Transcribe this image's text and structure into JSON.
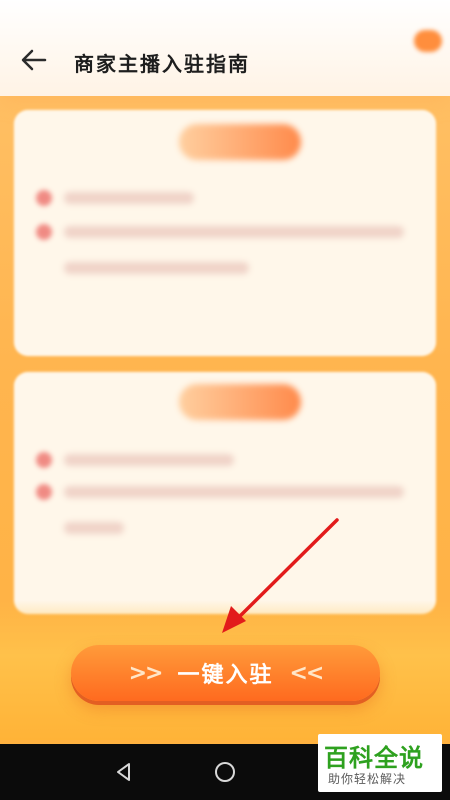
{
  "header": {
    "title": "商家主播入驻指南",
    "back_icon": "arrow-left-icon"
  },
  "cta": {
    "label": "一键入驻",
    "left_decoration": ">>",
    "right_decoration": "<<"
  },
  "navbar": {
    "icons": [
      "triangle-back-icon",
      "circle-home-icon",
      "square-recent-icon"
    ]
  },
  "watermark": {
    "main": "百科全说",
    "sub": "助你轻松解决"
  },
  "colors": {
    "background": "#FFB54F",
    "cta": "#FF7A2B",
    "annotation_arrow": "#E21B1B"
  }
}
